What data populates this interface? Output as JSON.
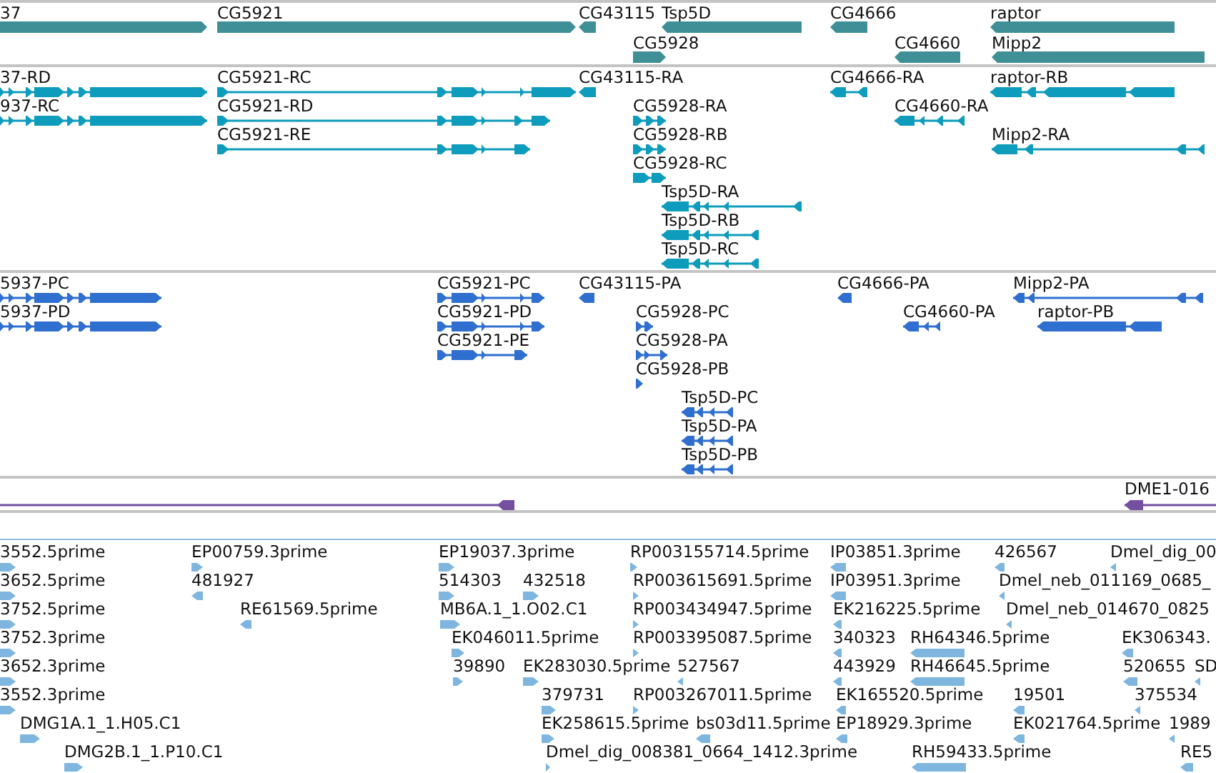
{
  "tracks": [
    {
      "kind": "gene",
      "features": [
        {
          "label": "37",
          "forward": true
        },
        {
          "label": "CG5921",
          "forward": true
        },
        {
          "label": "CG43115",
          "forward": false
        },
        {
          "label": "Tsp5D",
          "forward": false
        },
        {
          "label": "CG4666",
          "forward": false
        },
        {
          "label": "raptor",
          "forward": false
        },
        {
          "label": "CG5928",
          "forward": true
        },
        {
          "label": "CG4660",
          "forward": false
        },
        {
          "label": "Mipp2",
          "forward": false
        }
      ]
    },
    {
      "kind": "transcript",
      "features": [
        {
          "label": "37-RD",
          "forward": true
        },
        {
          "label": "937-RC",
          "forward": true
        },
        {
          "label": "CG5921-RC",
          "forward": true
        },
        {
          "label": "CG5921-RD",
          "forward": true
        },
        {
          "label": "CG5921-RE",
          "forward": true
        },
        {
          "label": "CG43115-RA",
          "forward": false
        },
        {
          "label": "CG5928-RA",
          "forward": true
        },
        {
          "label": "CG5928-RB",
          "forward": true
        },
        {
          "label": "CG5928-RC",
          "forward": true
        },
        {
          "label": "Tsp5D-RA",
          "forward": false
        },
        {
          "label": "Tsp5D-RB",
          "forward": false
        },
        {
          "label": "Tsp5D-RC",
          "forward": false
        },
        {
          "label": "CG4666-RA",
          "forward": false
        },
        {
          "label": "CG4660-RA",
          "forward": false
        },
        {
          "label": "raptor-RB",
          "forward": false
        },
        {
          "label": "Mipp2-RA",
          "forward": false
        }
      ]
    },
    {
      "kind": "protein",
      "features": [
        {
          "label": "5937-PC",
          "forward": true
        },
        {
          "label": "5937-PD",
          "forward": true
        },
        {
          "label": "CG5921-PC",
          "forward": true
        },
        {
          "label": "CG5921-PD",
          "forward": true
        },
        {
          "label": "CG5921-PE",
          "forward": true
        },
        {
          "label": "CG43115-PA",
          "forward": false
        },
        {
          "label": "CG5928-PC",
          "forward": true
        },
        {
          "label": "CG5928-PA",
          "forward": true
        },
        {
          "label": "CG5928-PB",
          "forward": true
        },
        {
          "label": "Tsp5D-PC",
          "forward": false
        },
        {
          "label": "Tsp5D-PA",
          "forward": false
        },
        {
          "label": "Tsp5D-PB",
          "forward": false
        },
        {
          "label": "CG4666-PA",
          "forward": false
        },
        {
          "label": "CG4660-PA",
          "forward": false
        },
        {
          "label": "Mipp2-PA",
          "forward": false
        },
        {
          "label": "raptor-PB",
          "forward": false
        }
      ]
    },
    {
      "kind": "alignment",
      "features": [
        {
          "forward": false
        },
        {
          "label": "DME1-016",
          "forward": false
        }
      ]
    },
    {
      "kind": "est",
      "features": [
        {
          "label": "3552.5prime",
          "forward": true
        },
        {
          "label": "EP00759.3prime",
          "forward": true
        },
        {
          "label": "EP19037.3prime",
          "forward": true
        },
        {
          "label": "RP003155714.5prime",
          "forward": true
        },
        {
          "label": "IP03851.3prime",
          "forward": false
        },
        {
          "label": "426567",
          "forward": false
        },
        {
          "label": "Dmel_dig_00",
          "forward": false
        },
        {
          "label": "3652.5prime",
          "forward": true
        },
        {
          "label": "481927",
          "forward": false
        },
        {
          "label": "514303",
          "forward": true
        },
        {
          "label": "432518",
          "forward": true
        },
        {
          "label": "RP003615691.5prime",
          "forward": true
        },
        {
          "label": "IP03951.3prime",
          "forward": false
        },
        {
          "label": "Dmel_neb_011169_0685_",
          "forward": false
        },
        {
          "label": "3752.5prime",
          "forward": true
        },
        {
          "label": "RE61569.5prime",
          "forward": false
        },
        {
          "label": "MB6A.1_1.O02.C1",
          "forward": true
        },
        {
          "label": "RP003434947.5prime",
          "forward": true
        },
        {
          "label": "EK216225.5prime",
          "forward": false
        },
        {
          "label": "Dmel_neb_014670_0825",
          "forward": false
        },
        {
          "label": "3752.3prime",
          "forward": true
        },
        {
          "label": "EK046011.5prime",
          "forward": true
        },
        {
          "label": "RP003395087.5prime",
          "forward": true
        },
        {
          "label": "340323",
          "forward": false
        },
        {
          "label": "RH64346.5prime",
          "forward": false
        },
        {
          "label": "EK306343.",
          "forward": false
        },
        {
          "label": "3652.3prime",
          "forward": true
        },
        {
          "label": "39890",
          "forward": true
        },
        {
          "label": "EK283030.5prime",
          "forward": true
        },
        {
          "label": "527567",
          "forward": false
        },
        {
          "label": "443929",
          "forward": false
        },
        {
          "label": "RH46645.5prime",
          "forward": false
        },
        {
          "label": "520655",
          "forward": false
        },
        {
          "label": "SD",
          "forward": false
        },
        {
          "label": "3552.3prime",
          "forward": true
        },
        {
          "label": "379731",
          "forward": true
        },
        {
          "label": "RP003267011.5prime",
          "forward": true
        },
        {
          "label": "EK165520.5prime",
          "forward": false
        },
        {
          "label": "19501",
          "forward": false
        },
        {
          "label": "375534",
          "forward": false
        },
        {
          "label": "DMG1A.1_1.H05.C1",
          "forward": true
        },
        {
          "label": "EK258615.5prime",
          "forward": true
        },
        {
          "label": "bs03d11.5prime",
          "forward": false
        },
        {
          "label": "EP18929.3prime",
          "forward": false
        },
        {
          "label": "EK021764.5prime",
          "forward": false
        },
        {
          "label": "1989",
          "forward": false
        },
        {
          "label": "DMG2B.1_1.P10.C1",
          "forward": true
        },
        {
          "label": "Dmel_dig_008381_0664_1412.3prime",
          "forward": true
        },
        {
          "label": "RH59433.5prime",
          "forward": false
        },
        {
          "label": "RE5",
          "forward": false
        }
      ]
    }
  ]
}
